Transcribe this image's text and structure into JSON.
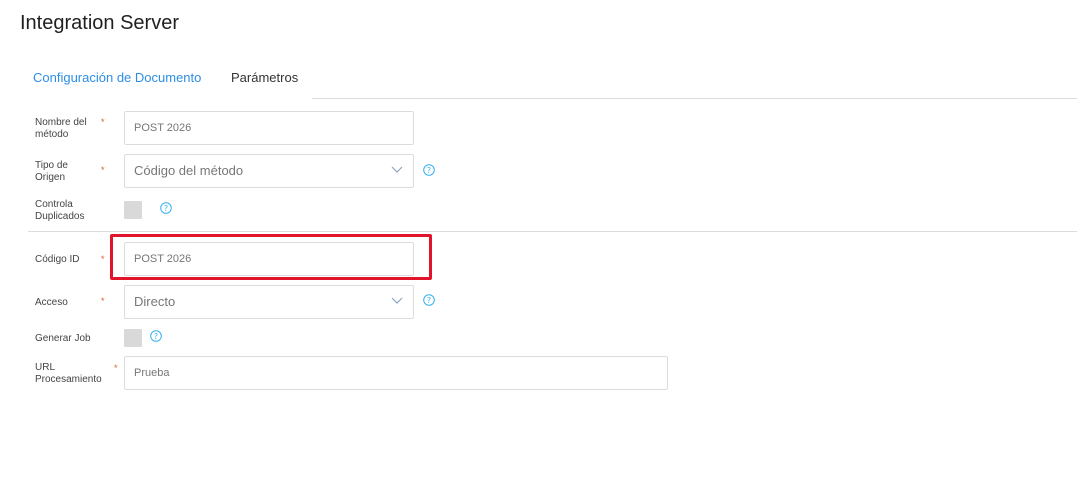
{
  "page": {
    "title": "Integration Server"
  },
  "tabs": [
    {
      "label": "Configuración de Documento",
      "active": true
    },
    {
      "label": "Parámetros",
      "active": false
    }
  ],
  "form": {
    "nombre_metodo": {
      "label_line1": "Nombre del",
      "label_line2": "método",
      "value": "POST 2026"
    },
    "tipo_origen": {
      "label_line1": "Tipo de",
      "label_line2": "Origen",
      "placeholder": "Código del método"
    },
    "controla_duplicados": {
      "label_line1": "Controla",
      "label_line2": "Duplicados",
      "checked": false
    },
    "codigo_id": {
      "label": "Código ID",
      "value": "POST 2026"
    },
    "acceso": {
      "label": "Acceso",
      "value": "Directo"
    },
    "generar_job": {
      "label": "Generar Job",
      "checked": false
    },
    "url_procesamiento": {
      "label_line1": "URL",
      "label_line2": "Procesamiento",
      "value": "Prueba"
    }
  },
  "required_marker": "*",
  "icons": {
    "help": "question-circle-icon",
    "dropdown": "chevron-down-icon"
  },
  "colors": {
    "accent": "#2d8ee6",
    "required": "#e05a2a",
    "highlight": "#e2142c",
    "help": "#35b0f0"
  }
}
